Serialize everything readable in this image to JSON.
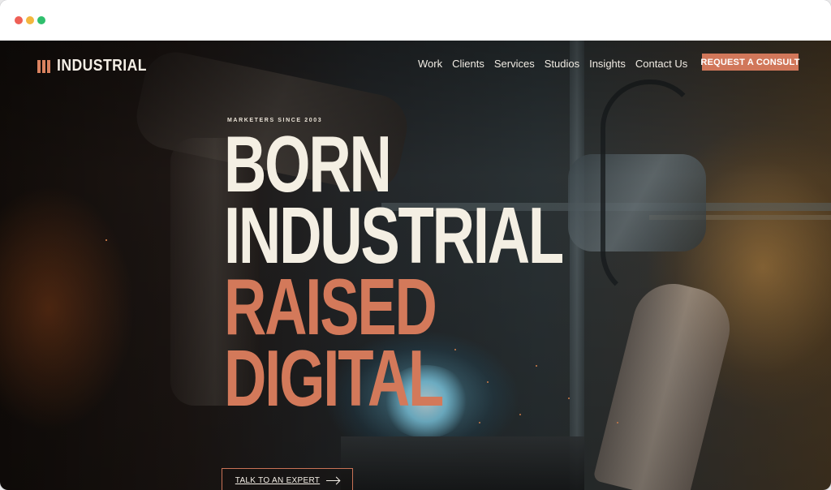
{
  "window": {
    "controls": [
      "close",
      "minimize",
      "maximize"
    ]
  },
  "brand": {
    "name": "INDUSTRIAL",
    "logo_icon": "bars-logo-icon",
    "accent_color": "#d3795a",
    "text_color": "#f4efe3"
  },
  "nav": {
    "items": [
      {
        "label": "Work"
      },
      {
        "label": "Clients"
      },
      {
        "label": "Services"
      },
      {
        "label": "Studios"
      },
      {
        "label": "Insights"
      },
      {
        "label": "Contact Us"
      }
    ],
    "cta_label": "REQUEST A CONSULT"
  },
  "hero": {
    "eyebrow": "MARKETERS SINCE 2003",
    "headline": {
      "line1": "BORN",
      "line2": "INDUSTRIAL",
      "line3": "RAISED",
      "line4": "DIGITAL"
    },
    "cta_label": "TALK TO AN EXPERT",
    "cta_icon": "arrow-right-icon"
  }
}
